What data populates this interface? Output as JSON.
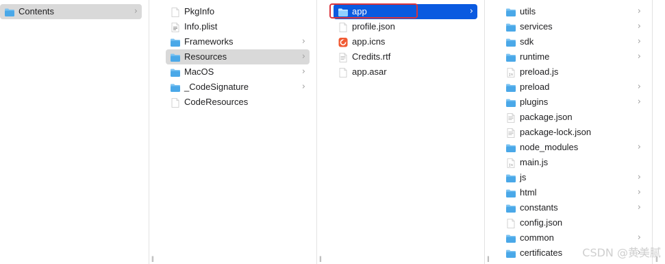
{
  "columns": [
    {
      "items": [
        {
          "name": "Contents",
          "type": "folder",
          "chevron": true,
          "selected": "gray"
        }
      ]
    },
    {
      "items": [
        {
          "name": "PkgInfo",
          "type": "file",
          "chevron": false
        },
        {
          "name": "Info.plist",
          "type": "plist",
          "chevron": false
        },
        {
          "name": "Frameworks",
          "type": "folder",
          "chevron": true
        },
        {
          "name": "Resources",
          "type": "folder",
          "chevron": true,
          "selected": "gray"
        },
        {
          "name": "MacOS",
          "type": "folder",
          "chevron": true
        },
        {
          "name": "_CodeSignature",
          "type": "folder",
          "chevron": true
        },
        {
          "name": "CodeResources",
          "type": "file",
          "chevron": false
        }
      ]
    },
    {
      "items": [
        {
          "name": "app",
          "type": "folder",
          "chevron": true,
          "selected": "blue"
        },
        {
          "name": "profile.json",
          "type": "file",
          "chevron": false
        },
        {
          "name": "app.icns",
          "type": "icns",
          "chevron": false
        },
        {
          "name": "Credits.rtf",
          "type": "doc",
          "chevron": false
        },
        {
          "name": "app.asar",
          "type": "file",
          "chevron": false
        }
      ]
    },
    {
      "items": [
        {
          "name": "utils",
          "type": "folder",
          "chevron": true
        },
        {
          "name": "services",
          "type": "folder",
          "chevron": true
        },
        {
          "name": "sdk",
          "type": "folder",
          "chevron": true
        },
        {
          "name": "runtime",
          "type": "folder",
          "chevron": true
        },
        {
          "name": "preload.js",
          "type": "js",
          "chevron": false
        },
        {
          "name": "preload",
          "type": "folder",
          "chevron": true
        },
        {
          "name": "plugins",
          "type": "folder",
          "chevron": true
        },
        {
          "name": "package.json",
          "type": "doc",
          "chevron": false
        },
        {
          "name": "package-lock.json",
          "type": "doc",
          "chevron": false
        },
        {
          "name": "node_modules",
          "type": "folder",
          "chevron": true
        },
        {
          "name": "main.js",
          "type": "js",
          "chevron": false
        },
        {
          "name": "js",
          "type": "folder",
          "chevron": true
        },
        {
          "name": "html",
          "type": "folder",
          "chevron": true
        },
        {
          "name": "constants",
          "type": "folder",
          "chevron": true
        },
        {
          "name": "config.json",
          "type": "file",
          "chevron": false
        },
        {
          "name": "common",
          "type": "folder",
          "chevron": true
        },
        {
          "name": "certificates",
          "type": "folder",
          "chevron": true
        }
      ]
    }
  ],
  "chevron_glyph": "›",
  "resize_glyph": "||",
  "watermark": "CSDN @黄美腻",
  "colors": {
    "selection_blue": "#0a5ae0",
    "selection_gray": "#d9d9d9",
    "folder": "#4aa8e8",
    "highlight_box": "#d9333b"
  }
}
